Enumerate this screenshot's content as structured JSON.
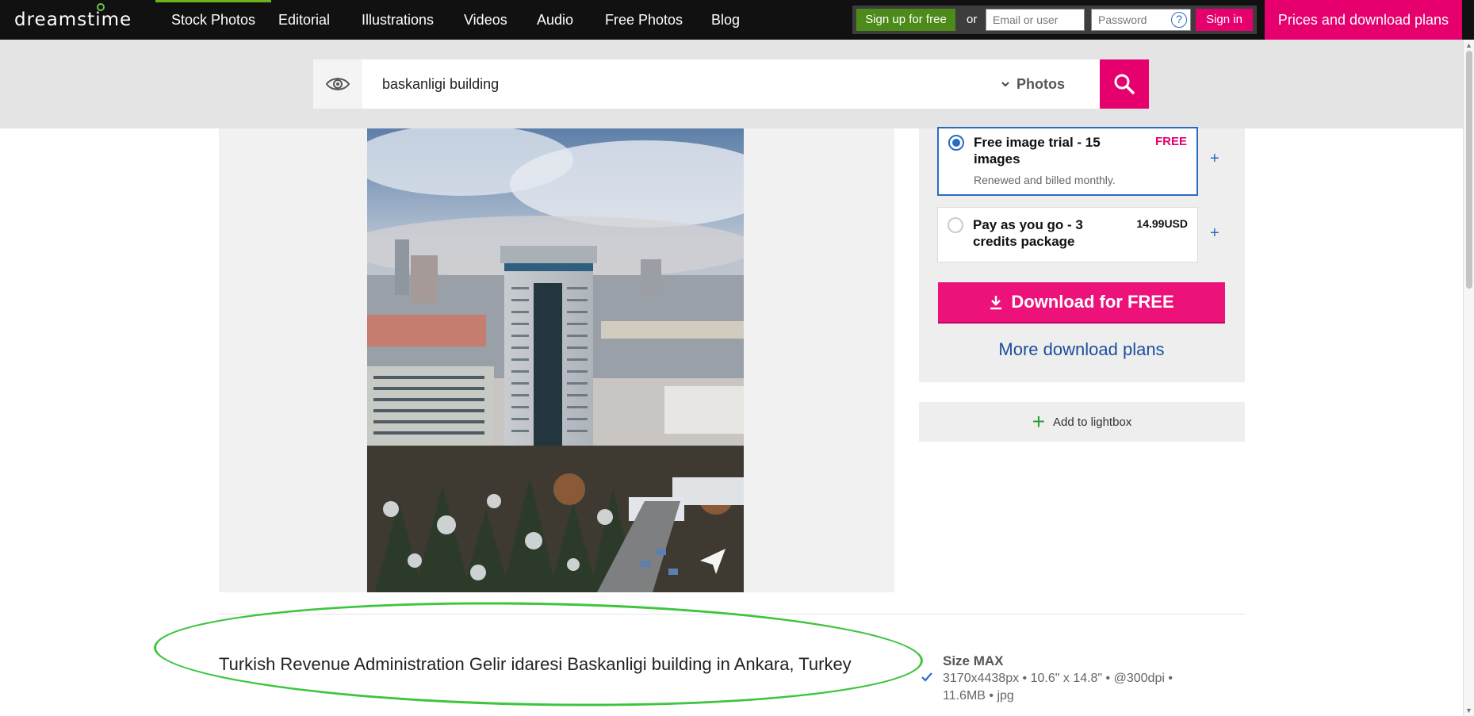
{
  "brand": {
    "name": "dreamstime"
  },
  "nav": {
    "items": [
      {
        "label": "Stock Photos",
        "active": true
      },
      {
        "label": "Editorial"
      },
      {
        "label": "Illustrations"
      },
      {
        "label": "Videos"
      },
      {
        "label": "Audio"
      },
      {
        "label": "Free Photos"
      },
      {
        "label": "Blog"
      }
    ],
    "signup_label": "Sign up for free",
    "or_label": "or",
    "email_placeholder": "Email or user",
    "password_placeholder": "Password",
    "help_symbol": "?",
    "signin_label": "Sign in",
    "plans_label": "Prices and download plans"
  },
  "search": {
    "query": "baskanligi building",
    "type_label": "Photos"
  },
  "plans": [
    {
      "title": "Free image trial - 15 images",
      "subtitle": "Renewed and billed monthly.",
      "price": "FREE",
      "plus": "+",
      "selected": true
    },
    {
      "title": "Pay as you go - 3 credits package",
      "price": "14.99USD",
      "plus": "+",
      "selected": false
    }
  ],
  "download": {
    "label": "Download for FREE",
    "more_label": "More download plans"
  },
  "lightbox": {
    "label": "Add to lightbox",
    "plus": "+"
  },
  "photo": {
    "title": "Turkish Revenue Administration Gelir idaresi Baskanligi building in Ankara, Turkey"
  },
  "size": {
    "label": "Size MAX",
    "details": "3170x4438px • 10.6\" x 14.8\" • @300dpi • 11.6MB • jpg"
  },
  "colors": {
    "accent": "#e5006e",
    "link": "#1a4f9c",
    "highlight": "#3ec53e",
    "nav_bg": "#111111",
    "active_nav": "#69b31b"
  },
  "icons": [
    "eye-icon",
    "search-icon",
    "download-arrow-icon",
    "plus-icon",
    "help-icon",
    "check-icon",
    "chevron-down-icon",
    "send-icon"
  ]
}
